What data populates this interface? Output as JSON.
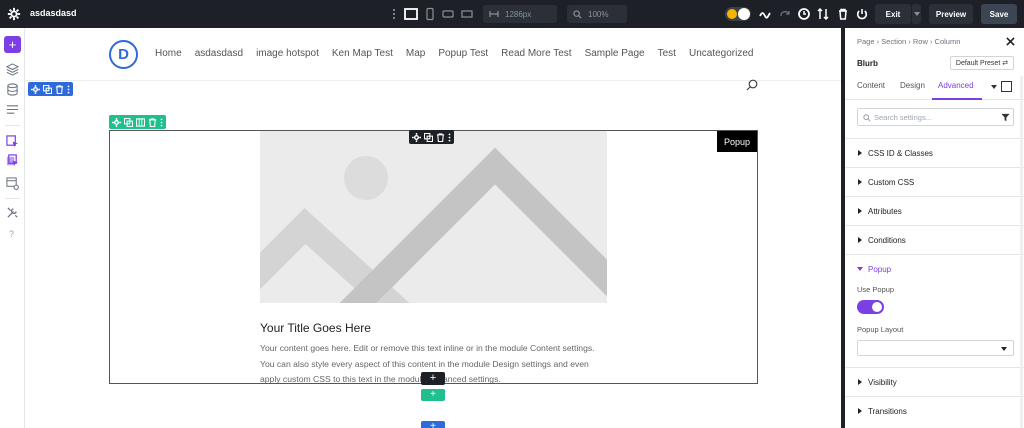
{
  "topbar": {
    "site_name": "asdasdasd",
    "width_value": "1286px",
    "zoom_value": "100%",
    "exit_label": "Exit",
    "preview_label": "Preview",
    "save_label": "Save"
  },
  "header": {
    "logo_letter": "D",
    "nav": [
      "Home",
      "asdasdasd",
      "image hotspot",
      "Ken Map Test",
      "Map",
      "Popup Test",
      "Read More Test",
      "Sample Page",
      "Test",
      "Uncategorized"
    ]
  },
  "blurb": {
    "popup_badge": "Popup",
    "title": "Your Title Goes Here",
    "text": "Your content goes here. Edit or remove this text inline or in the module Content settings. You can also style every aspect of this content in the module Design settings and even apply custom CSS to this text in the module Advanced settings."
  },
  "panel": {
    "breadcrumb": "Page › Section › Row › Column",
    "module_name": "Blurb",
    "preset_label": "Default Preset ⇄",
    "tabs": [
      "Content",
      "Design",
      "Advanced"
    ],
    "active_tab": "Advanced",
    "search_placeholder": "Search settings...",
    "groups_top": [
      "CSS ID & Classes",
      "Custom CSS",
      "Attributes",
      "Conditions"
    ],
    "popup_group": "Popup",
    "use_popup_label": "Use Popup",
    "use_popup_value": true,
    "popup_layout_label": "Popup Layout",
    "popup_layout_value": "",
    "groups_bottom": [
      "Visibility",
      "Transitions"
    ]
  },
  "colors": {
    "accent": "#7b3fe4",
    "section": "#2f6bd8",
    "row": "#1fbf8f",
    "toolbar": "#1d2127"
  }
}
